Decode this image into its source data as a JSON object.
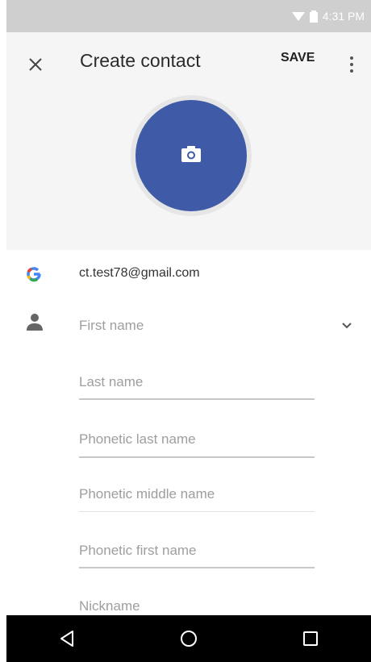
{
  "status_bar": {
    "time": "4:31 PM",
    "icons": [
      "wifi-icon",
      "battery-icon"
    ]
  },
  "header": {
    "close_icon": "close-icon",
    "title": "Create contact",
    "save_label": "SAVE",
    "more_icon": "more-vert-icon",
    "photo_icon": "camera-icon",
    "photo_color": "#3f5aa6"
  },
  "account": {
    "icon": "google-icon",
    "letter": "G",
    "email": "ct.test78@gmail.com"
  },
  "name_section": {
    "icon": "person-icon",
    "fields": [
      {
        "placeholder": "First name"
      },
      {
        "placeholder": "Last name"
      },
      {
        "placeholder": "Phonetic last name"
      },
      {
        "placeholder": "Phonetic middle name"
      },
      {
        "placeholder": "Phonetic first name"
      },
      {
        "placeholder": "Nickname"
      }
    ],
    "expand_icon": "chevron-down-icon"
  },
  "nav_bar": {
    "buttons": [
      "back-icon",
      "home-icon",
      "recents-icon"
    ]
  }
}
